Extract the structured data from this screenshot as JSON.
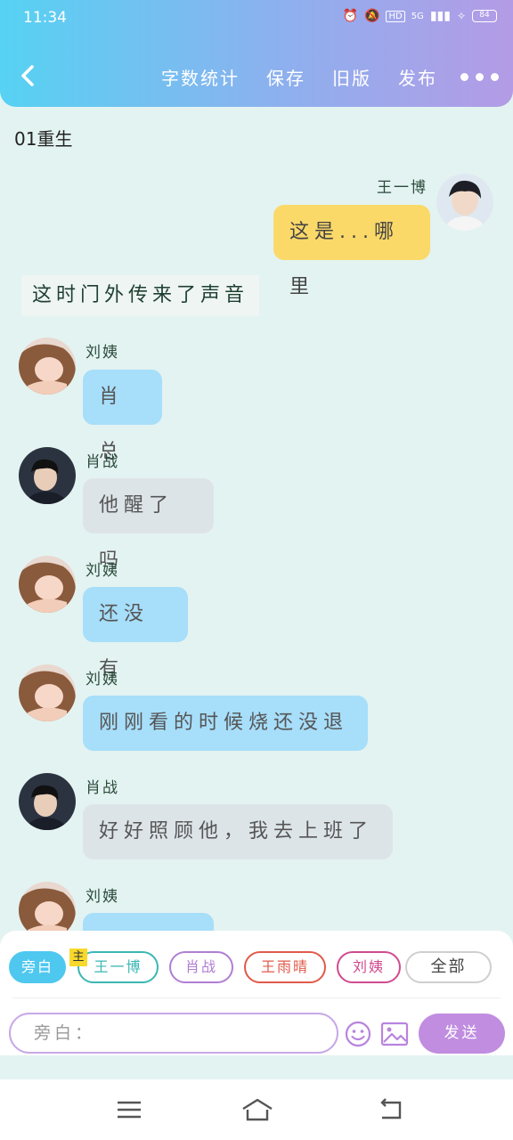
{
  "status": {
    "time": "11:34",
    "network": "5G",
    "battery": "84"
  },
  "header": {
    "nav": [
      "字数统计",
      "保存",
      "旧版",
      "发布"
    ]
  },
  "chapter_title": "01重生",
  "messages": [
    {
      "speaker": "王一博",
      "text": "这是...哪里",
      "side": "right",
      "color": "yellow"
    },
    {
      "narration": "这时门外传来了声音"
    },
    {
      "speaker": "刘姨",
      "text": "肖总",
      "side": "left",
      "color": "blue"
    },
    {
      "speaker": "肖战",
      "text": "他醒了吗",
      "side": "left",
      "color": "gray"
    },
    {
      "speaker": "刘姨",
      "text": "还没有",
      "side": "left",
      "color": "blue"
    },
    {
      "speaker": "刘姨",
      "text": "刚刚看的时候烧还没退",
      "side": "left",
      "color": "blue"
    },
    {
      "speaker": "肖战",
      "text": "好好照顾他，我去上班了",
      "side": "left",
      "color": "gray"
    },
    {
      "speaker": "刘姨",
      "text": "",
      "side": "left",
      "color": "blue"
    }
  ],
  "roles": {
    "chips": [
      "旁白",
      "王一博",
      "肖战",
      "王雨晴",
      "刘姨",
      "全部"
    ],
    "main_badge": "主",
    "colors": [
      "#4fc8ef",
      "#3ab7b3",
      "#b07fd3",
      "#e05a4a",
      "#d04a8f",
      "#bbbbbb"
    ]
  },
  "composer": {
    "placeholder": "旁白：",
    "send_label": "发送"
  },
  "icons": [
    "back-chevron-icon",
    "more-dots-icon",
    "emoji-icon",
    "image-icon",
    "menu-icon",
    "home-icon",
    "back-icon"
  ]
}
